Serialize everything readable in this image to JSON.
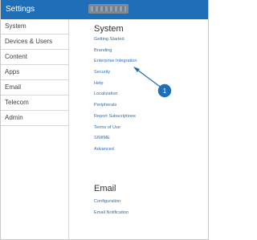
{
  "header": {
    "title": "Settings"
  },
  "sidebar": {
    "items": [
      {
        "label": "System"
      },
      {
        "label": "Devices & Users"
      },
      {
        "label": "Content"
      },
      {
        "label": "Apps"
      },
      {
        "label": "Email"
      },
      {
        "label": "Telecom"
      },
      {
        "label": "Admin"
      }
    ]
  },
  "main": {
    "system": {
      "title": "System",
      "links": [
        "Getting Started",
        "Branding",
        "Enterprise Integration",
        "Security",
        "Help",
        "Localization",
        "Peripherals",
        "Report Subscriptions",
        "Terms of Use",
        "S/MIME",
        "Advanced"
      ]
    },
    "email": {
      "title": "Email",
      "links": [
        "Configuration",
        "Email Notification"
      ]
    }
  },
  "annotation": {
    "marker_label": "1",
    "marker_color": "#1f6fb8"
  },
  "colors": {
    "header": "#1f6fb8",
    "link": "#2d6fb7",
    "sidebar_text": "#444444"
  }
}
